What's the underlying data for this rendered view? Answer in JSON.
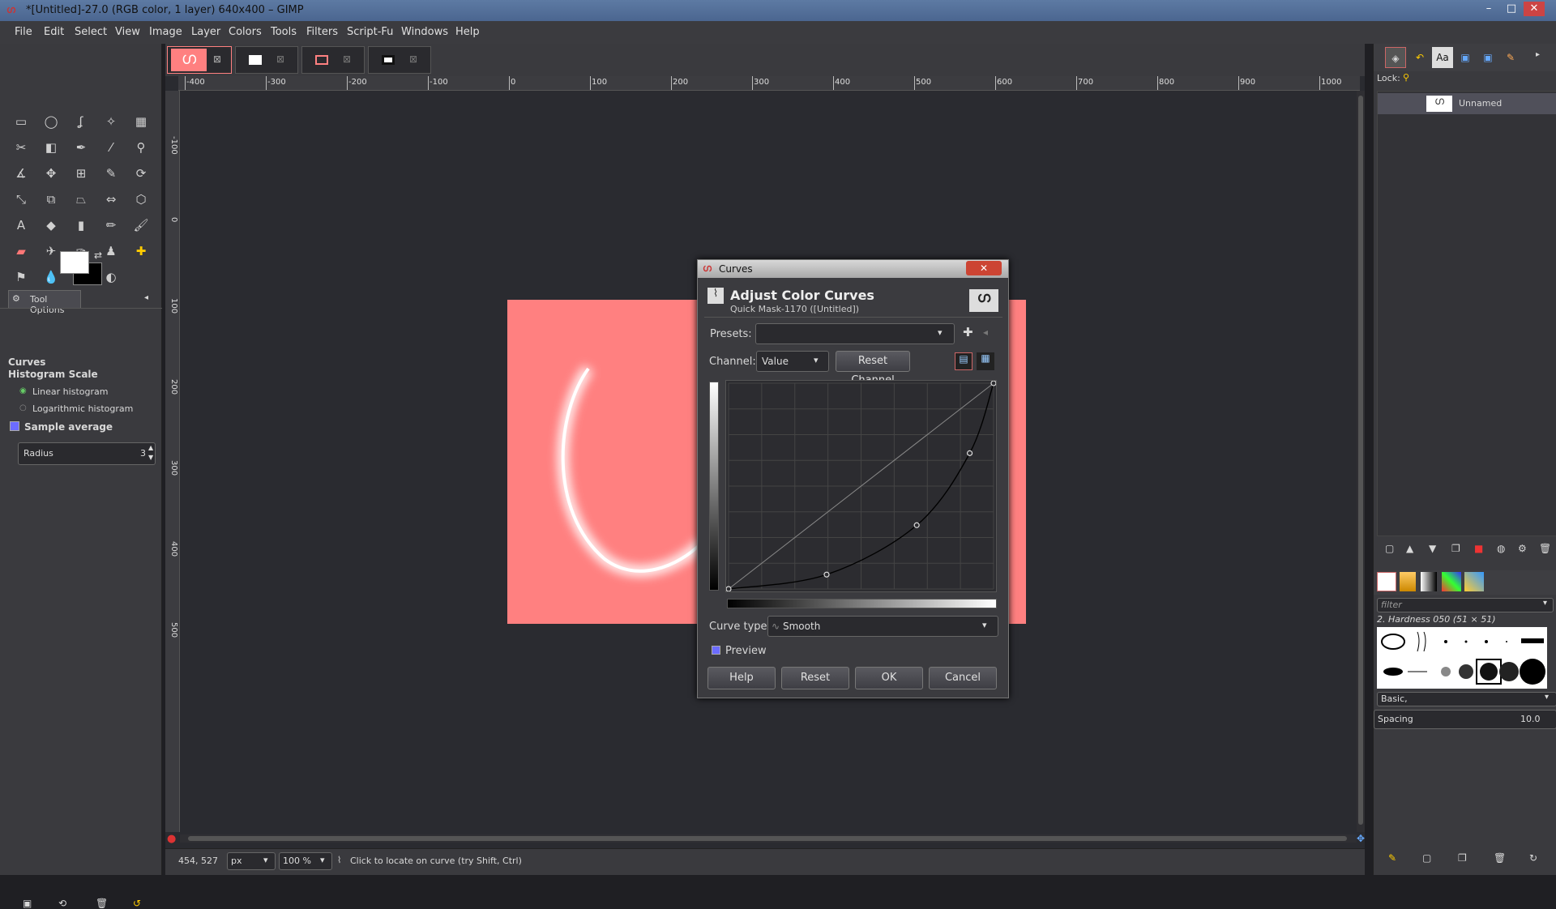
{
  "window": {
    "title": "*[Untitled]-27.0 (RGB color, 1 layer) 640x400 – GIMP",
    "minimize": "–",
    "maximize": "□",
    "close": "✕"
  },
  "menu": [
    "File",
    "Edit",
    "Select",
    "View",
    "Image",
    "Layer",
    "Colors",
    "Tools",
    "Filters",
    "Script-Fu",
    "Windows",
    "Help"
  ],
  "tool_options": {
    "tab": "Tool Options",
    "tool_name": "Curves",
    "section": "Histogram Scale",
    "option_linear": "Linear histogram",
    "option_log": "Logarithmic histogram",
    "sample_average": "Sample average",
    "radius_label": "Radius",
    "radius_value": "3"
  },
  "rulers": {
    "h": [
      "-400",
      "-300",
      "-200",
      "-100",
      "0",
      "100",
      "200",
      "300",
      "400",
      "500",
      "600",
      "700",
      "800",
      "900",
      "1000"
    ],
    "v": [
      "-100",
      "0",
      "100",
      "200",
      "300",
      "400",
      "500"
    ]
  },
  "curves": {
    "window_title": "Curves",
    "heading": "Adjust Color Curves",
    "subheading": "Quick Mask-1170 ([Untitled])",
    "presets_label": "Presets:",
    "presets_value": "",
    "channel_label": "Channel:",
    "channel_value": "Value",
    "reset_channel": "Reset Channel",
    "curve_type_label": "Curve type:",
    "curve_type_value": "Smooth",
    "preview_label": "Preview",
    "help": "Help",
    "reset": "Reset",
    "ok": "OK",
    "cancel": "Cancel",
    "points": [
      [
        0,
        0
      ],
      [
        0.37,
        0.07
      ],
      [
        0.71,
        0.31
      ],
      [
        0.91,
        0.66
      ],
      [
        1,
        1
      ]
    ]
  },
  "layers": {
    "lock_label": "Lock:",
    "layer_name": "Unnamed"
  },
  "brushes": {
    "filter_placeholder": "filter",
    "current_brush": "2. Hardness 050 (51 × 51)",
    "tag": "Basic,",
    "spacing_label": "Spacing",
    "spacing_value": "10.0"
  },
  "status": {
    "coords": "454, 527",
    "unit": "px",
    "zoom": "100 %",
    "message": "Click to locate on curve (try Shift, Ctrl)"
  },
  "colors": {
    "fg": "#ffffff",
    "bg": "#000000",
    "image": "#ff8080"
  }
}
